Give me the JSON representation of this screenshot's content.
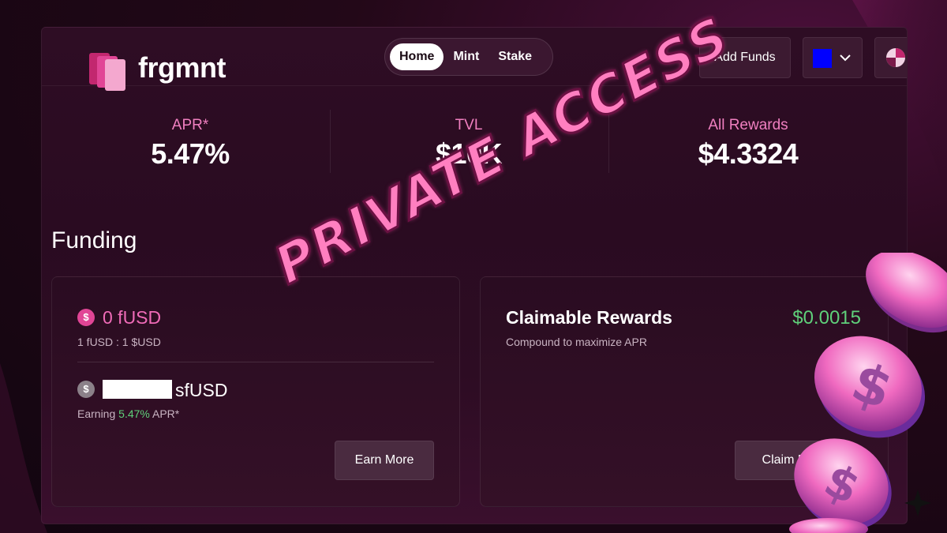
{
  "brand": {
    "name": "frgmnt"
  },
  "nav": {
    "items": [
      {
        "label": "Home",
        "active": true
      },
      {
        "label": "Mint",
        "active": false
      },
      {
        "label": "Stake",
        "active": false
      }
    ]
  },
  "header": {
    "add_funds_label": "Add Funds",
    "wallet_color": "#0000ff"
  },
  "stats": [
    {
      "label": "APR*",
      "value": "5.47%"
    },
    {
      "label": "TVL",
      "value": "$10K"
    },
    {
      "label": "All Rewards",
      "value": "$4.3324"
    }
  ],
  "funding": {
    "title": "Funding",
    "fusd": {
      "icon": "dollar-coin-icon",
      "value": "0 fUSD",
      "rate": "1 fUSD : 1 $USD"
    },
    "sfusd": {
      "icon": "dollar-coin-icon",
      "unit": "sfUSD",
      "earning_prefix": "Earning ",
      "earning_apr": "5.47%",
      "earning_suffix": " APR*"
    },
    "earn_more_label": "Earn More"
  },
  "rewards": {
    "title": "Claimable Rewards",
    "amount": "$0.0015",
    "subtitle": "Compound to maximize APR",
    "claim_label": "Claim R"
  },
  "overlay": {
    "stamp_text": "PRIVATE ACCESS"
  },
  "colors": {
    "accent_pink": "#f07fc0",
    "positive_green": "#5fd07a",
    "background": "#230818"
  }
}
